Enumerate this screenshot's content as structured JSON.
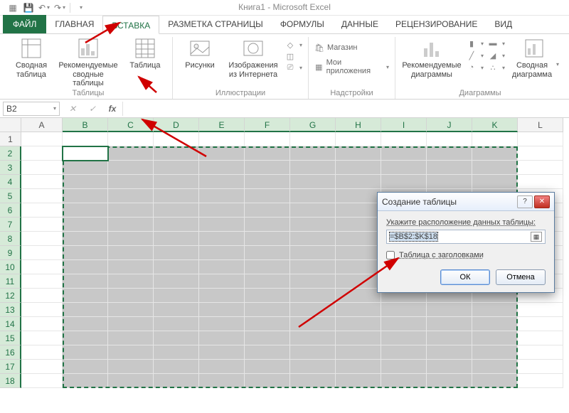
{
  "app": {
    "title": "Книга1 - Microsoft Excel"
  },
  "qat": {
    "save": "💾",
    "undo": "↶",
    "redo": "↷"
  },
  "tabs": {
    "file": "ФАЙЛ",
    "home": "ГЛАВНАЯ",
    "insert": "ВСТАВКА",
    "pagelayout": "РАЗМЕТКА СТРАНИЦЫ",
    "formulas": "ФОРМУЛЫ",
    "data": "ДАННЫЕ",
    "review": "РЕЦЕНЗИРОВАНИЕ",
    "view": "ВИД"
  },
  "ribbon": {
    "tables": {
      "pivot": "Сводная таблица",
      "rec_pivot": "Рекомендуемые сводные таблицы",
      "table": "Таблица",
      "group": "Таблицы"
    },
    "illus": {
      "pictures": "Рисунки",
      "online_pics": "Изображения из Интернета",
      "group": "Иллюстрации"
    },
    "addins": {
      "store": "Магазин",
      "myapps": "Мои приложения",
      "group": "Надстройки"
    },
    "charts": {
      "rec": "Рекомендуемые диаграммы",
      "pivotchart": "Сводная диаграмма",
      "group": "Диаграммы"
    }
  },
  "namebox": "B2",
  "columns": [
    "A",
    "B",
    "C",
    "D",
    "E",
    "F",
    "G",
    "H",
    "I",
    "J",
    "K",
    "L"
  ],
  "rows": [
    "1",
    "2",
    "3",
    "4",
    "5",
    "6",
    "7",
    "8",
    "9",
    "10",
    "11",
    "12",
    "13",
    "14",
    "15",
    "16",
    "17",
    "18"
  ],
  "dialog": {
    "title": "Создание таблицы",
    "prompt": "Укажите расположение данных таблицы:",
    "range": "=$B$2:$K$18",
    "checkbox": "Таблица с заголовками",
    "ok": "ОК",
    "cancel": "Отмена"
  }
}
